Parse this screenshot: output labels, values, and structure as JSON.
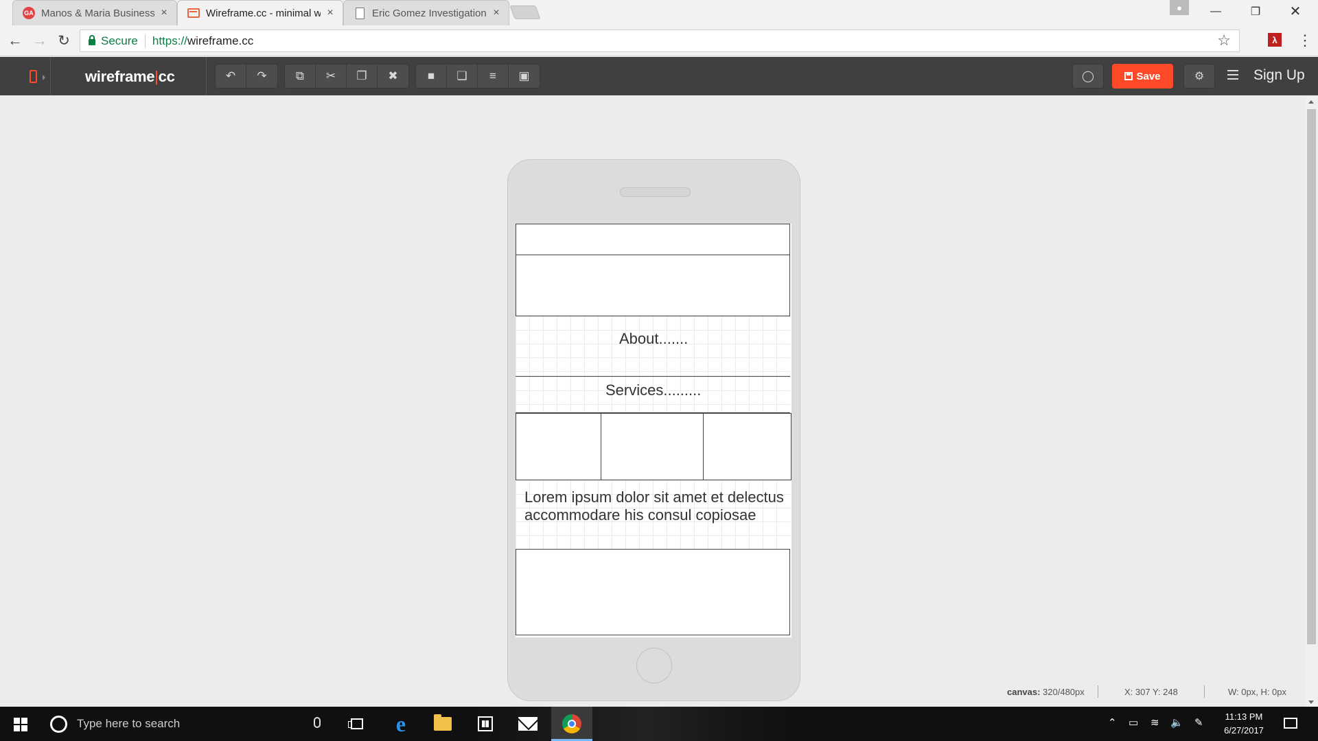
{
  "browser": {
    "tabs": [
      {
        "title": "Manos & Maria Business",
        "favicon": "ga-logo-icon",
        "active": false
      },
      {
        "title": "Wireframe.cc - minimal w",
        "favicon": "wireframe-favicon-icon",
        "active": true
      },
      {
        "title": "Eric Gomez Investigation",
        "favicon": "document-icon",
        "active": false
      }
    ],
    "tab_close_glyph": "×",
    "secure_label": "Secure",
    "url_scheme": "https://",
    "url_host": "wireframe.cc"
  },
  "app": {
    "logo_left": "wireframe",
    "logo_sep": "|",
    "logo_right": "cc",
    "save_label": "Save",
    "signup_label": "Sign Up",
    "accent_color": "#ff4a2a"
  },
  "wireframe": {
    "about_text": "About.......",
    "services_text": "Services.........",
    "lorem_text": "Lorem ipsum dolor sit amet et delectus accommodare his consul copiosae"
  },
  "status": {
    "canvas_label": "canvas:",
    "canvas_value": "320/480px",
    "xy_value": "X: 307 Y: 248",
    "wh_value": "W: 0px, H: 0px"
  },
  "taskbar": {
    "search_placeholder": "Type here to search",
    "time": "11:13 PM",
    "date": "6/27/2017"
  }
}
